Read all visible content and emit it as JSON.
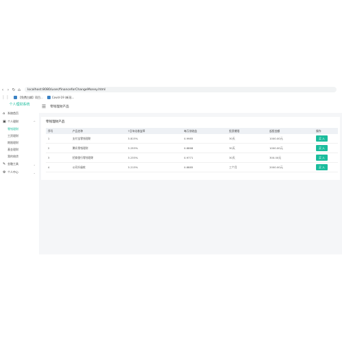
{
  "browser": {
    "url": "localhost:8080/user/financeforChangeMoney.html"
  },
  "bookmarks": [
    {
      "label": "【免费白嫖】项目..."
    },
    {
      "label": "Covid-19 (新冠..."
    }
  ],
  "sidebar": {
    "title": "个人理财系统",
    "home_label": "系统首页",
    "personal_label": "个人理财",
    "sub_items": [
      {
        "label": "零钱理财"
      },
      {
        "label": "工资理财"
      },
      {
        "label": "期限理财"
      },
      {
        "label": "基金理财"
      },
      {
        "label": "我的借贷"
      }
    ],
    "tools_label": "金融工具",
    "my_label": "个人中心"
  },
  "main": {
    "breadcrumb": "零钱理财产品",
    "card_title": "零钱理财产品",
    "columns": [
      "序号",
      "产品名称",
      "7日年化收益率",
      "每万份收益",
      "投资期限",
      "起投金额",
      "操作"
    ],
    "rows": [
      {
        "no": "1",
        "name": "支付宝零钱理财",
        "rate": "3.815%",
        "income": "0.9985",
        "term": "30天",
        "min": "1000.00元",
        "action": "买 入"
      },
      {
        "no": "2",
        "name": "腾讯零钱理财",
        "rate": "3.255%",
        "income": "0.8868",
        "term": "30天",
        "min": "1000.00元",
        "action": "买 入"
      },
      {
        "no": "3",
        "name": "招商银行零钱理财",
        "rate": "3.235%",
        "income": "0.9771",
        "term": "30天",
        "min": "300.00元",
        "action": "买 入"
      },
      {
        "no": "4",
        "name": "公司升级款",
        "rate": "3.215%",
        "income": "0.8885",
        "term": "三个月",
        "min": "2000.00元",
        "action": "买 入"
      }
    ]
  }
}
